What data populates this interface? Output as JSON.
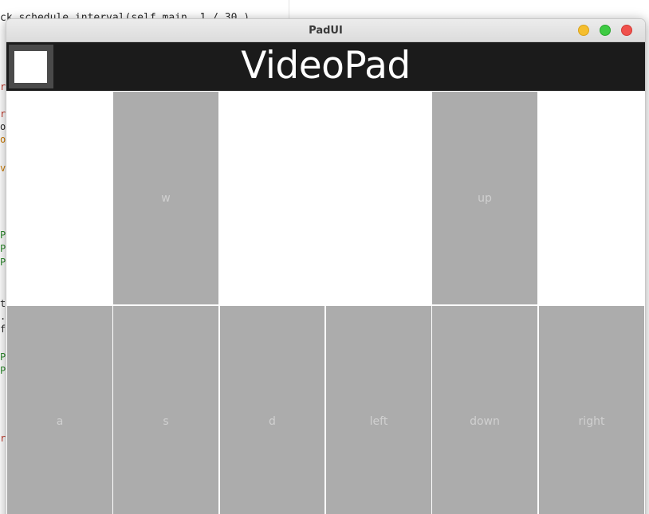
{
  "editor": {
    "top_line": "ck.schedule_interval(self.main, 1 / 30 )"
  },
  "window": {
    "title": "PadUI"
  },
  "header": {
    "title": "VideoPad"
  },
  "pad": {
    "top_row": [
      {
        "label": "w"
      },
      {
        "label": "up"
      }
    ],
    "bottom_row": [
      {
        "label": "a"
      },
      {
        "label": "s"
      },
      {
        "label": "d"
      },
      {
        "label": "left"
      },
      {
        "label": "down"
      },
      {
        "label": "right"
      }
    ]
  },
  "colors": {
    "header_bg": "#1b1b1b",
    "key_bg": "#acacac",
    "key_text": "#d0d0d0",
    "close": "#f0514c",
    "minimize": "#f5be2e",
    "maximize": "#3ecb43"
  }
}
